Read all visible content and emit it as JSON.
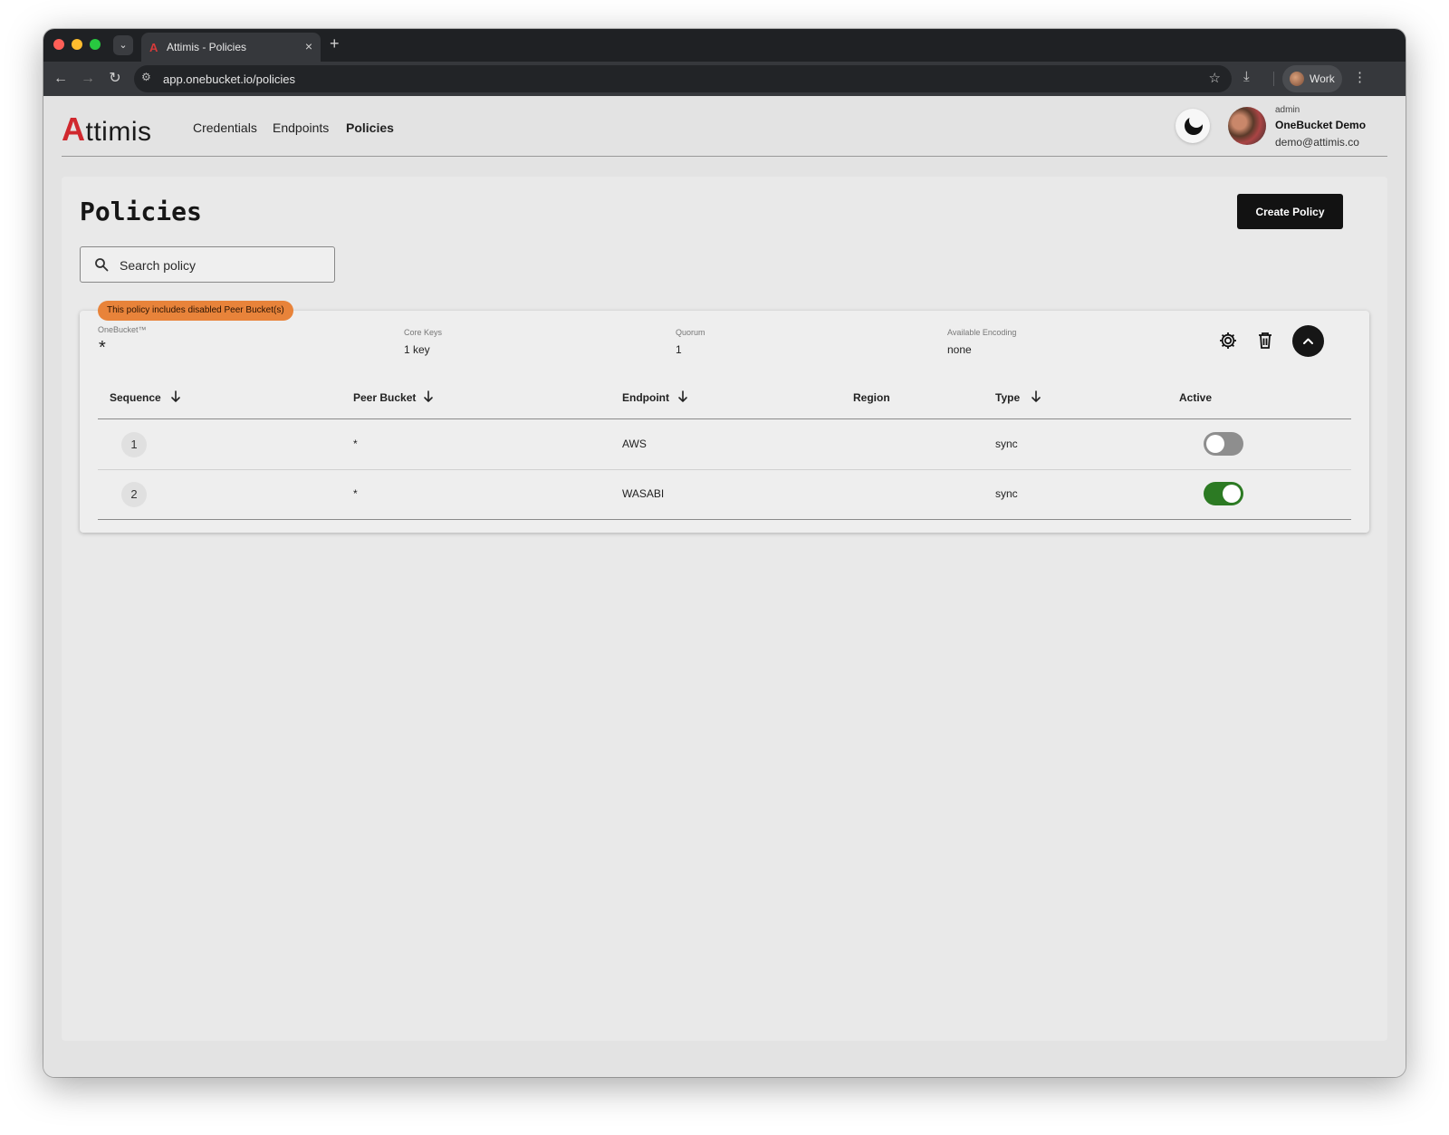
{
  "browser": {
    "tab_title": "Attimis - Policies",
    "tab_favicon": "A",
    "close_glyph": "×",
    "new_tab_glyph": "+",
    "url": "app.onebucket.io/policies",
    "profile_label": "Work",
    "icons": [
      "chevron-down-icon",
      "back-icon",
      "forward-icon",
      "reload-icon",
      "site-settings-icon",
      "star-icon",
      "download-icon",
      "kebab-menu-icon"
    ]
  },
  "header": {
    "logo_initial": "A",
    "logo_rest": "ttimis",
    "nav": [
      "Credentials",
      "Endpoints",
      "Policies"
    ],
    "active_nav": "Policies",
    "user": {
      "role": "admin",
      "org": "OneBucket Demo",
      "email": "demo@attimis.co"
    }
  },
  "page": {
    "title": "Policies",
    "create_button": "Create Policy",
    "search_placeholder": "Search policy"
  },
  "policy": {
    "warning": "This policy includes disabled Peer Bucket(s)",
    "warning_color": "#e8833a",
    "onebucket_label": "OneBucket™",
    "onebucket_value": "*",
    "core_keys_label": "Core Keys",
    "core_keys_value": "1 key",
    "quorum_label": "Quorum",
    "quorum_value": "1",
    "encoding_label": "Available Encoding",
    "encoding_value": "none",
    "columns": [
      "Sequence",
      "Peer Bucket",
      "Endpoint",
      "Region",
      "Type",
      "Active"
    ],
    "rows": [
      {
        "sequence": "1",
        "peer_bucket": "*",
        "endpoint": "AWS",
        "region": "",
        "type": "sync",
        "active": false
      },
      {
        "sequence": "2",
        "peer_bucket": "*",
        "endpoint": "WASABI",
        "region": "",
        "type": "sync",
        "active": true
      }
    ],
    "toggle_on_color": "#2c7a23",
    "toggle_off_color": "#8e8e8e"
  }
}
